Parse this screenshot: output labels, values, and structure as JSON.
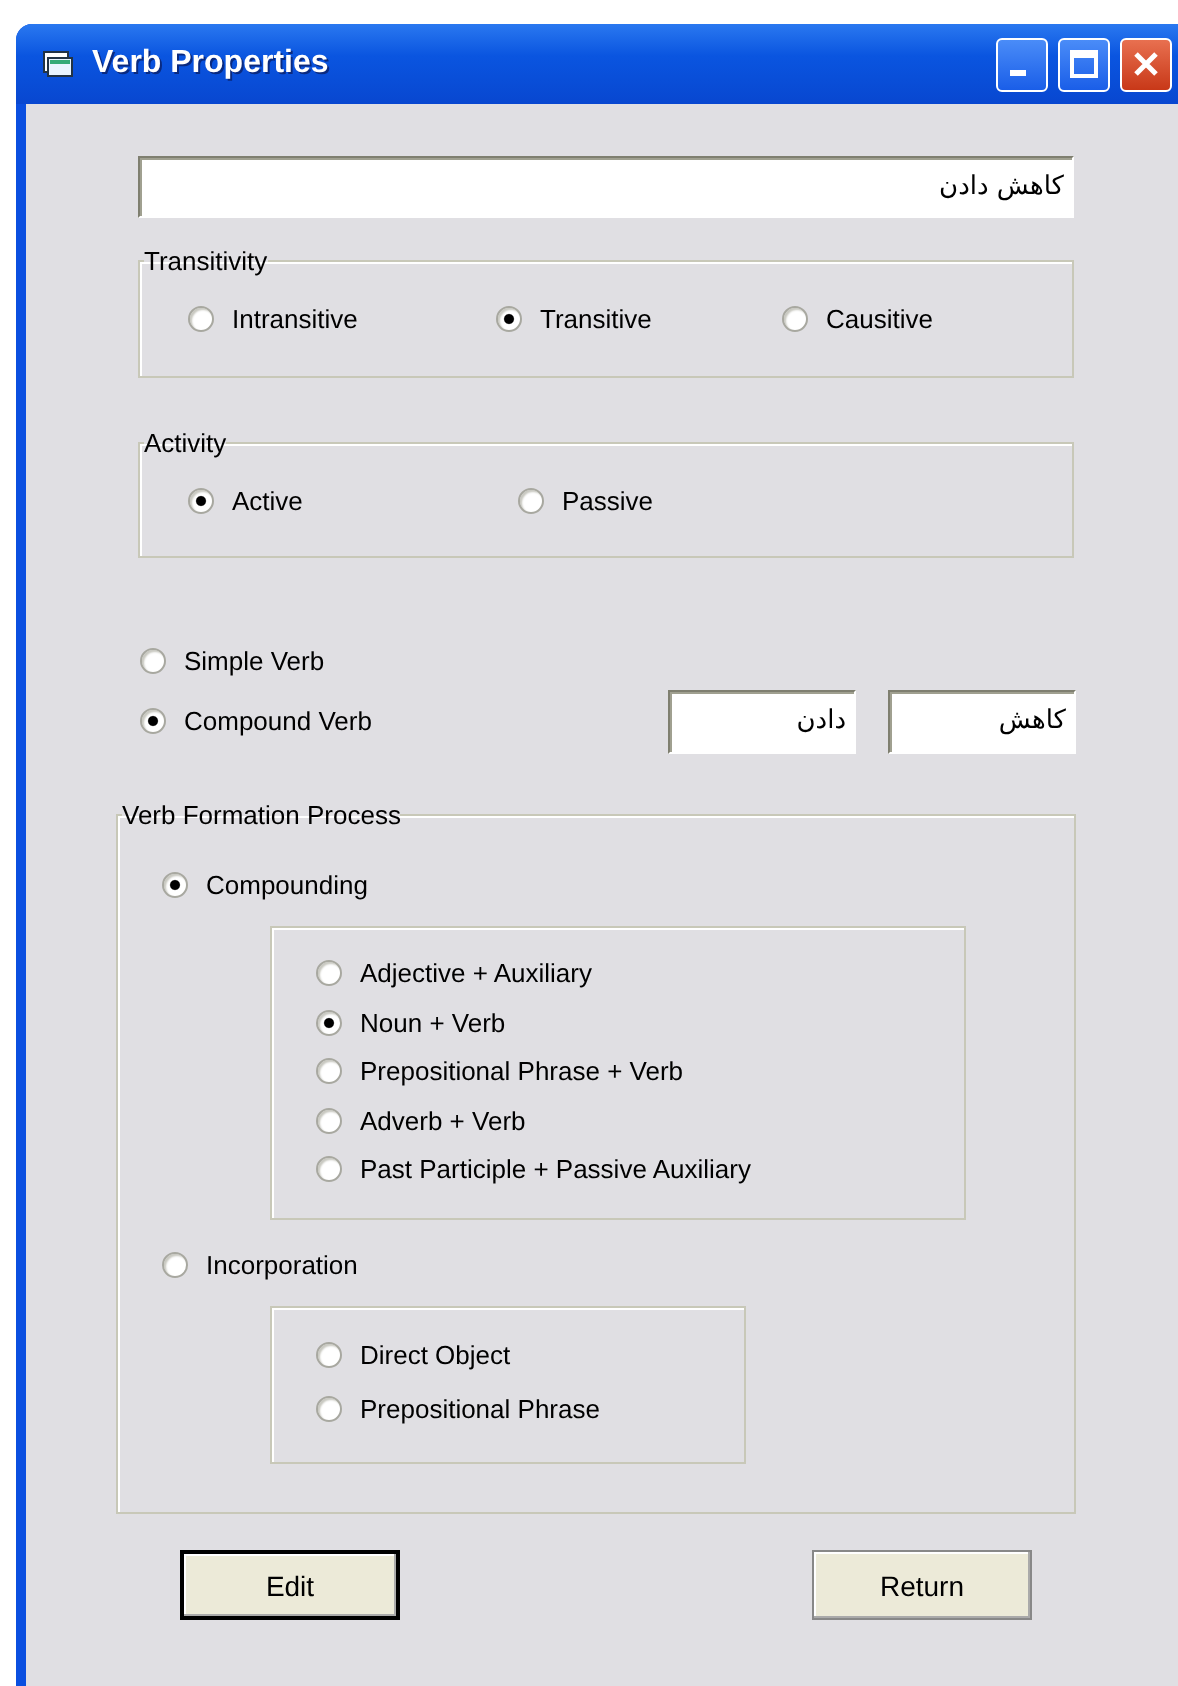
{
  "window": {
    "title": "Verb Properties"
  },
  "verb_field": {
    "value": "کاهش دادن"
  },
  "transitivity": {
    "label": "Transitivity",
    "options": [
      {
        "label": "Intransitive",
        "selected": false
      },
      {
        "label": "Transitive",
        "selected": true
      },
      {
        "label": "Causitive",
        "selected": false
      }
    ]
  },
  "activity": {
    "label": "Activity",
    "options": [
      {
        "label": "Active",
        "selected": true
      },
      {
        "label": "Passive",
        "selected": false
      }
    ]
  },
  "verb_type": {
    "options": [
      {
        "label": "Simple Verb",
        "selected": false
      },
      {
        "label": "Compound Verb",
        "selected": true
      }
    ],
    "parts": [
      {
        "value": "کاهش"
      },
      {
        "value": "دادن"
      }
    ]
  },
  "formation": {
    "label": "Verb Formation Process",
    "processes": [
      {
        "label": "Compounding",
        "selected": true,
        "options": [
          {
            "label": "Adjective + Auxiliary",
            "selected": false
          },
          {
            "label": "Noun + Verb",
            "selected": true
          },
          {
            "label": "Prepositional Phrase + Verb",
            "selected": false
          },
          {
            "label": "Adverb + Verb",
            "selected": false
          },
          {
            "label": "Past Participle + Passive Auxiliary",
            "selected": false
          }
        ]
      },
      {
        "label": "Incorporation",
        "selected": false,
        "options": [
          {
            "label": "Direct Object",
            "selected": false
          },
          {
            "label": "Prepositional Phrase",
            "selected": false
          }
        ]
      }
    ]
  },
  "buttons": [
    {
      "label": "Edit",
      "default": true
    },
    {
      "label": "Return",
      "default": false
    }
  ]
}
